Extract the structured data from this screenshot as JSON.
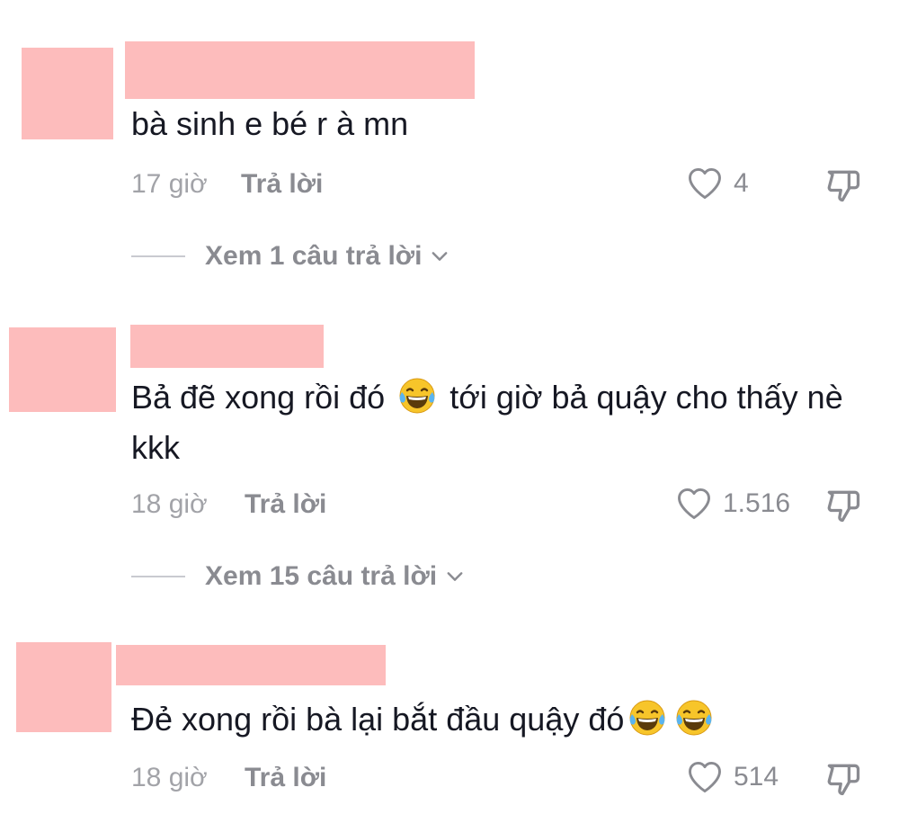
{
  "comments": [
    {
      "text": "bà sinh e bé r à mn",
      "time": "17 giờ",
      "reply_label": "Trả lời",
      "likes": "4",
      "view_replies": "Xem 1 câu trả lời"
    },
    {
      "text_part1": "Bả đẽ xong rồi đó",
      "text_part2": "tới giờ bả quậy cho thấy nè kkk",
      "time": "18 giờ",
      "reply_label": "Trả lời",
      "likes": "1.516",
      "view_replies": "Xem 15 câu trả lời"
    },
    {
      "text": "Đẻ xong rồi bà lại bắt đầu quậy đó",
      "time": "18 giờ",
      "reply_label": "Trả lời",
      "likes": "514"
    }
  ],
  "colors": {
    "redaction": "#fdbcbc",
    "text": "#161823",
    "muted": "#8a8b91"
  },
  "icons": [
    "heart-outline-icon",
    "thumbs-down-icon",
    "chevron-down-icon",
    "laughing-tears-emoji"
  ]
}
